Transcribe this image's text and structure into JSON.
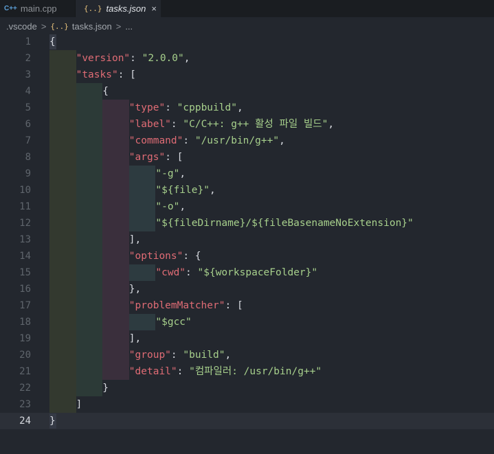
{
  "tabs": [
    {
      "icon": "C++",
      "label": "main.cpp",
      "active": false
    },
    {
      "icon": "{..}",
      "label": "tasks.json",
      "active": true,
      "close": "×"
    }
  ],
  "breadcrumb": {
    "folder": ".vscode",
    "sep1": ">",
    "icon": "{..}",
    "file": "tasks.json",
    "sep2": ">",
    "more": "..."
  },
  "colors": {
    "key": "#e06c75",
    "string": "#a7d08c",
    "punct": "#d7dae0",
    "background": "#23272e"
  },
  "current_line": 24,
  "lines": [
    {
      "n": "1",
      "indent": 0,
      "tokens": [
        {
          "t": "p",
          "v": "{"
        }
      ]
    },
    {
      "n": "2",
      "indent": 1,
      "tokens": [
        {
          "t": "k",
          "v": "\"version\""
        },
        {
          "t": "p",
          "v": ": "
        },
        {
          "t": "s",
          "v": "\"2.0.0\""
        },
        {
          "t": "p",
          "v": ","
        }
      ]
    },
    {
      "n": "3",
      "indent": 1,
      "tokens": [
        {
          "t": "k",
          "v": "\"tasks\""
        },
        {
          "t": "p",
          "v": ": ["
        }
      ]
    },
    {
      "n": "4",
      "indent": 2,
      "tokens": [
        {
          "t": "p",
          "v": "{"
        }
      ]
    },
    {
      "n": "5",
      "indent": 3,
      "tokens": [
        {
          "t": "k",
          "v": "\"type\""
        },
        {
          "t": "p",
          "v": ": "
        },
        {
          "t": "s",
          "v": "\"cppbuild\""
        },
        {
          "t": "p",
          "v": ","
        }
      ]
    },
    {
      "n": "6",
      "indent": 3,
      "tokens": [
        {
          "t": "k",
          "v": "\"label\""
        },
        {
          "t": "p",
          "v": ": "
        },
        {
          "t": "s",
          "v": "\"C/C++: g++ 활성 파일 빌드\""
        },
        {
          "t": "p",
          "v": ","
        }
      ]
    },
    {
      "n": "7",
      "indent": 3,
      "tokens": [
        {
          "t": "k",
          "v": "\"command\""
        },
        {
          "t": "p",
          "v": ": "
        },
        {
          "t": "s",
          "v": "\"/usr/bin/g++\""
        },
        {
          "t": "p",
          "v": ","
        }
      ]
    },
    {
      "n": "8",
      "indent": 3,
      "tokens": [
        {
          "t": "k",
          "v": "\"args\""
        },
        {
          "t": "p",
          "v": ": ["
        }
      ]
    },
    {
      "n": "9",
      "indent": 4,
      "tokens": [
        {
          "t": "s",
          "v": "\"-g\""
        },
        {
          "t": "p",
          "v": ","
        }
      ]
    },
    {
      "n": "10",
      "indent": 4,
      "tokens": [
        {
          "t": "s",
          "v": "\"${file}\""
        },
        {
          "t": "p",
          "v": ","
        }
      ]
    },
    {
      "n": "11",
      "indent": 4,
      "tokens": [
        {
          "t": "s",
          "v": "\"-o\""
        },
        {
          "t": "p",
          "v": ","
        }
      ]
    },
    {
      "n": "12",
      "indent": 4,
      "tokens": [
        {
          "t": "s",
          "v": "\"${fileDirname}/${fileBasenameNoExtension}\""
        }
      ]
    },
    {
      "n": "13",
      "indent": 3,
      "tokens": [
        {
          "t": "p",
          "v": "],"
        }
      ]
    },
    {
      "n": "14",
      "indent": 3,
      "tokens": [
        {
          "t": "k",
          "v": "\"options\""
        },
        {
          "t": "p",
          "v": ": {"
        }
      ]
    },
    {
      "n": "15",
      "indent": 4,
      "tokens": [
        {
          "t": "k",
          "v": "\"cwd\""
        },
        {
          "t": "p",
          "v": ": "
        },
        {
          "t": "s",
          "v": "\"${workspaceFolder}\""
        }
      ]
    },
    {
      "n": "16",
      "indent": 3,
      "tokens": [
        {
          "t": "p",
          "v": "},"
        }
      ]
    },
    {
      "n": "17",
      "indent": 3,
      "tokens": [
        {
          "t": "k",
          "v": "\"problemMatcher\""
        },
        {
          "t": "p",
          "v": ": ["
        }
      ]
    },
    {
      "n": "18",
      "indent": 4,
      "tokens": [
        {
          "t": "s",
          "v": "\"$gcc\""
        }
      ]
    },
    {
      "n": "19",
      "indent": 3,
      "tokens": [
        {
          "t": "p",
          "v": "],"
        }
      ]
    },
    {
      "n": "20",
      "indent": 3,
      "tokens": [
        {
          "t": "k",
          "v": "\"group\""
        },
        {
          "t": "p",
          "v": ": "
        },
        {
          "t": "s",
          "v": "\"build\""
        },
        {
          "t": "p",
          "v": ","
        }
      ]
    },
    {
      "n": "21",
      "indent": 3,
      "tokens": [
        {
          "t": "k",
          "v": "\"detail\""
        },
        {
          "t": "p",
          "v": ": "
        },
        {
          "t": "s",
          "v": "\"컴파일러: /usr/bin/g++\""
        }
      ]
    },
    {
      "n": "22",
      "indent": 2,
      "tokens": [
        {
          "t": "p",
          "v": "}"
        }
      ]
    },
    {
      "n": "23",
      "indent": 1,
      "tokens": [
        {
          "t": "p",
          "v": "]"
        }
      ]
    },
    {
      "n": "24",
      "indent": 0,
      "tokens": [
        {
          "t": "p",
          "v": "}"
        }
      ]
    }
  ]
}
